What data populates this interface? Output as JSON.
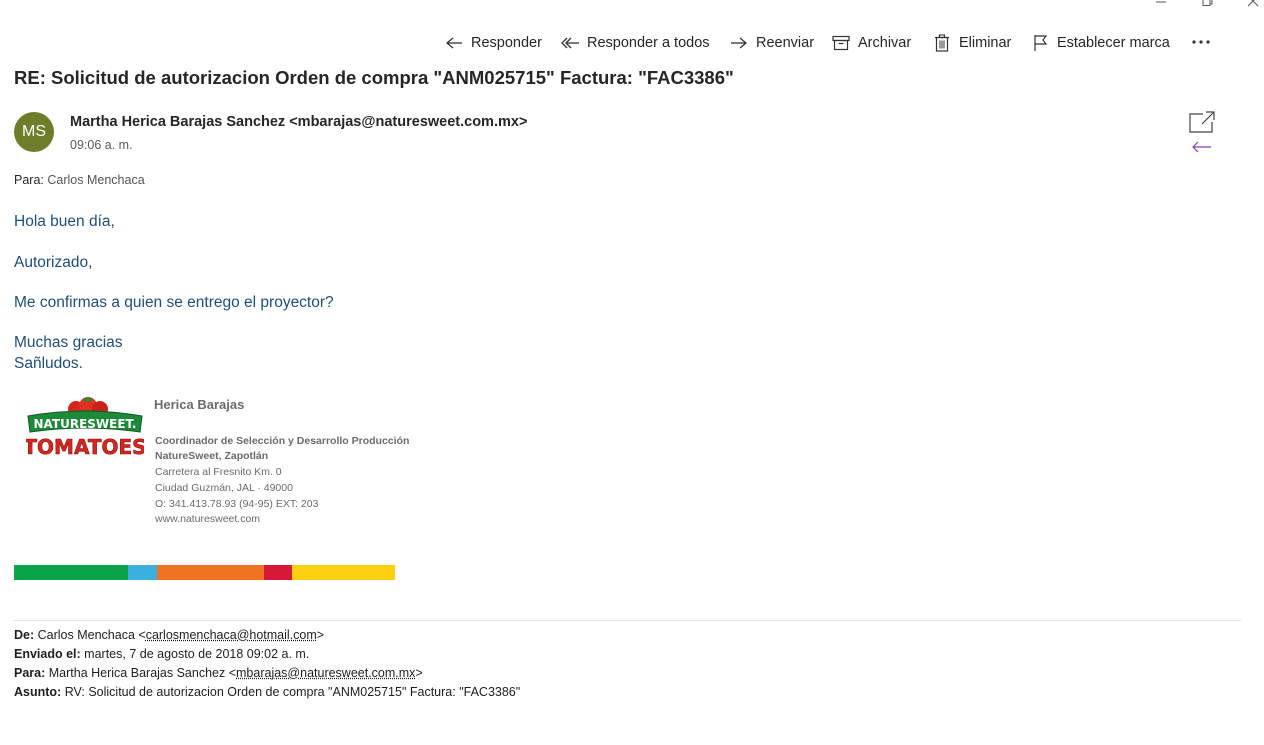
{
  "toolbar": {
    "reply": "Responder",
    "reply_all": "Responder a todos",
    "forward": "Reenviar",
    "archive": "Archivar",
    "delete": "Eliminar",
    "flag": "Establecer marca",
    "more_icon": "more-icon"
  },
  "message": {
    "subject": "RE: Solicitud de autorizacion Orden de compra \"ANM025715\" Factura: \"FAC3386\"",
    "avatar_initials": "MS",
    "avatar_color": "#6d7e2b",
    "sender": "Martha Herica Barajas Sanchez <mbarajas@naturesweet.com.mx>",
    "time": "09:06 a. m.",
    "to_label": "Para:",
    "to_name": "Carlos Menchaca",
    "body": {
      "line1": "Hola buen día,",
      "line2": "Autorizado,",
      "line3": "Me confirmas a quien se entrego el proyector?",
      "line4": "Muchas gracias",
      "line5": "Sañludos."
    },
    "body_color": "#1f4e79"
  },
  "signature": {
    "logo_text_top": "NATURESWEET.",
    "logo_text_bottom": "TOMATOES",
    "name": "Herica Barajas",
    "title": "Coordinador de Selección y Desarrollo Producción",
    "company": "NatureSweet, Zapotlán",
    "address1": "Carretera al Fresnito Km. 0",
    "address2": "Ciudad Guzmán, JAL · 49000",
    "phone": "O: 341.413.78.93 (94-95)  EXT: 203",
    "web": "www.naturesweet.com",
    "bar_colors": [
      "#0aa548",
      "#3bb0e0",
      "#f07223",
      "#d7193a",
      "#fbd010"
    ]
  },
  "quoted": {
    "from_label": "De:",
    "from_name": "Carlos Menchaca <",
    "from_email": "carlosmenchaca@hotmail.com",
    "from_close": ">",
    "sent_label": "Enviado el:",
    "sent_value": "martes, 7 de agosto de 2018 09:02 a. m.",
    "to_label": "Para:",
    "to_name": "Martha Herica Barajas Sanchez <",
    "to_email": "mbarajas@naturesweet.com.mx",
    "to_close": ">",
    "subject_label": "Asunto:",
    "subject_value": "RV: Solicitud de autorizacion Orden de compra \"ANM025715\" Factura: \"FAC3386\""
  }
}
